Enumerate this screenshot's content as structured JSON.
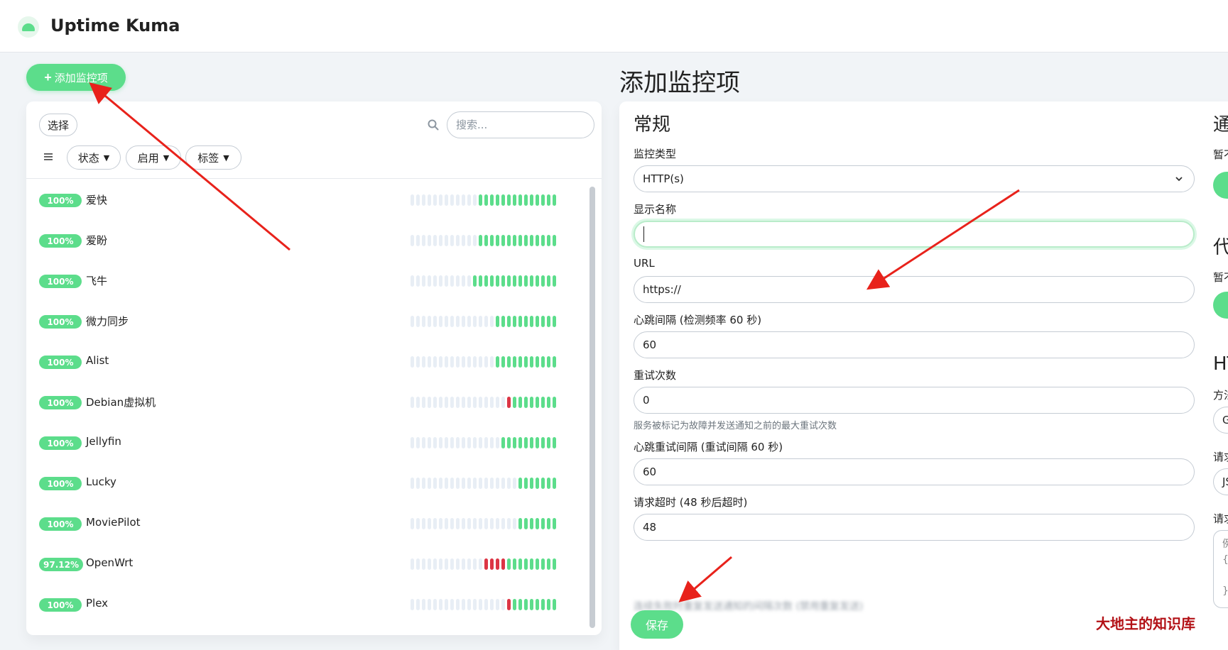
{
  "header": {
    "brand": "Uptime Kuma"
  },
  "sidebar": {
    "add_button": "添加监控项",
    "select_button": "选择",
    "search_placeholder": "搜索...",
    "filters": [
      {
        "label": "状态"
      },
      {
        "label": "启用"
      },
      {
        "label": "标签"
      }
    ],
    "monitors": [
      {
        "uptime": "100%",
        "name": "爱快",
        "beats": "eeeeeeeeeeeeuuuuuuuuuuuuuu"
      },
      {
        "uptime": "100%",
        "name": "爱盼",
        "beats": "eeeeeeeeeeeeuuuuuuuuuuuuuu"
      },
      {
        "uptime": "100%",
        "name": "飞牛",
        "beats": "eeeeeeeeeeeuuuuuuuuuuuuuuu"
      },
      {
        "uptime": "100%",
        "name": "微力同步",
        "beats": "eeeeeeeeeeeeeeeuuuuuuuuuuu"
      },
      {
        "uptime": "100%",
        "name": "Alist",
        "beats": "eeeeeeeeeeeeeeeuuuuuuuuuuu"
      },
      {
        "uptime": "100%",
        "name": "Debian虚拟机",
        "beats": "eeeeeeeeeeeeeeeeeduuuuuuuu"
      },
      {
        "uptime": "100%",
        "name": "Jellyfin",
        "beats": "eeeeeeeeeeeeeeeeuuuuuuuuuu"
      },
      {
        "uptime": "100%",
        "name": "Lucky",
        "beats": "eeeeeeeeeeeeeeeeeeeuuuuuuu"
      },
      {
        "uptime": "100%",
        "name": "MoviePilot",
        "beats": "eeeeeeeeeeeeeeeeeeeuuuuuuu"
      },
      {
        "uptime": "97.12%",
        "name": "OpenWrt",
        "beats": "eeeeeeeeeeeeedddduuuuuuuuu"
      },
      {
        "uptime": "100%",
        "name": "Plex",
        "beats": "eeeeeeeeeeeeeeeeeduuuuuuuu"
      }
    ]
  },
  "form": {
    "page_title": "添加监控项",
    "general_title": "常规",
    "monitor_type_label": "监控类型",
    "monitor_type_value": "HTTP(s)",
    "display_name_label": "显示名称",
    "url_label": "URL",
    "url_value": "https://",
    "heartbeat_label": "心跳间隔 (检测频率 60 秒)",
    "heartbeat_value": "60",
    "retries_label": "重试次数",
    "retries_value": "0",
    "retries_help": "服务被标记为故障并发送通知之前的最大重试次数",
    "retry_interval_label": "心跳重试间隔 (重试间隔 60 秒)",
    "retry_interval_value": "60",
    "timeout_label": "请求超时 (48 秒后超时)",
    "timeout_value": "48",
    "resend_label_blurred": "连续失败时重复发送通知的间隔次数 (禁用重复发送)",
    "save_button": "保存"
  },
  "right_column_partial": {
    "notify_title": "通",
    "notify_sub": "暂不",
    "proxy_title": "代",
    "proxy_sub": "暂不",
    "http_title": "HT",
    "method_label": "方法",
    "method_value": "GE",
    "body_enc_label": "请求",
    "body_enc_value": "JS",
    "body_label": "请求",
    "body_placeholder_lines": [
      "例",
      "{",
      "",
      "}"
    ]
  },
  "watermark": "大地主的知识库",
  "colors": {
    "accent": "#5cdd8b",
    "down": "#dc3545",
    "empty_beat": "#e8eef5",
    "annotation": "#e8221b"
  }
}
